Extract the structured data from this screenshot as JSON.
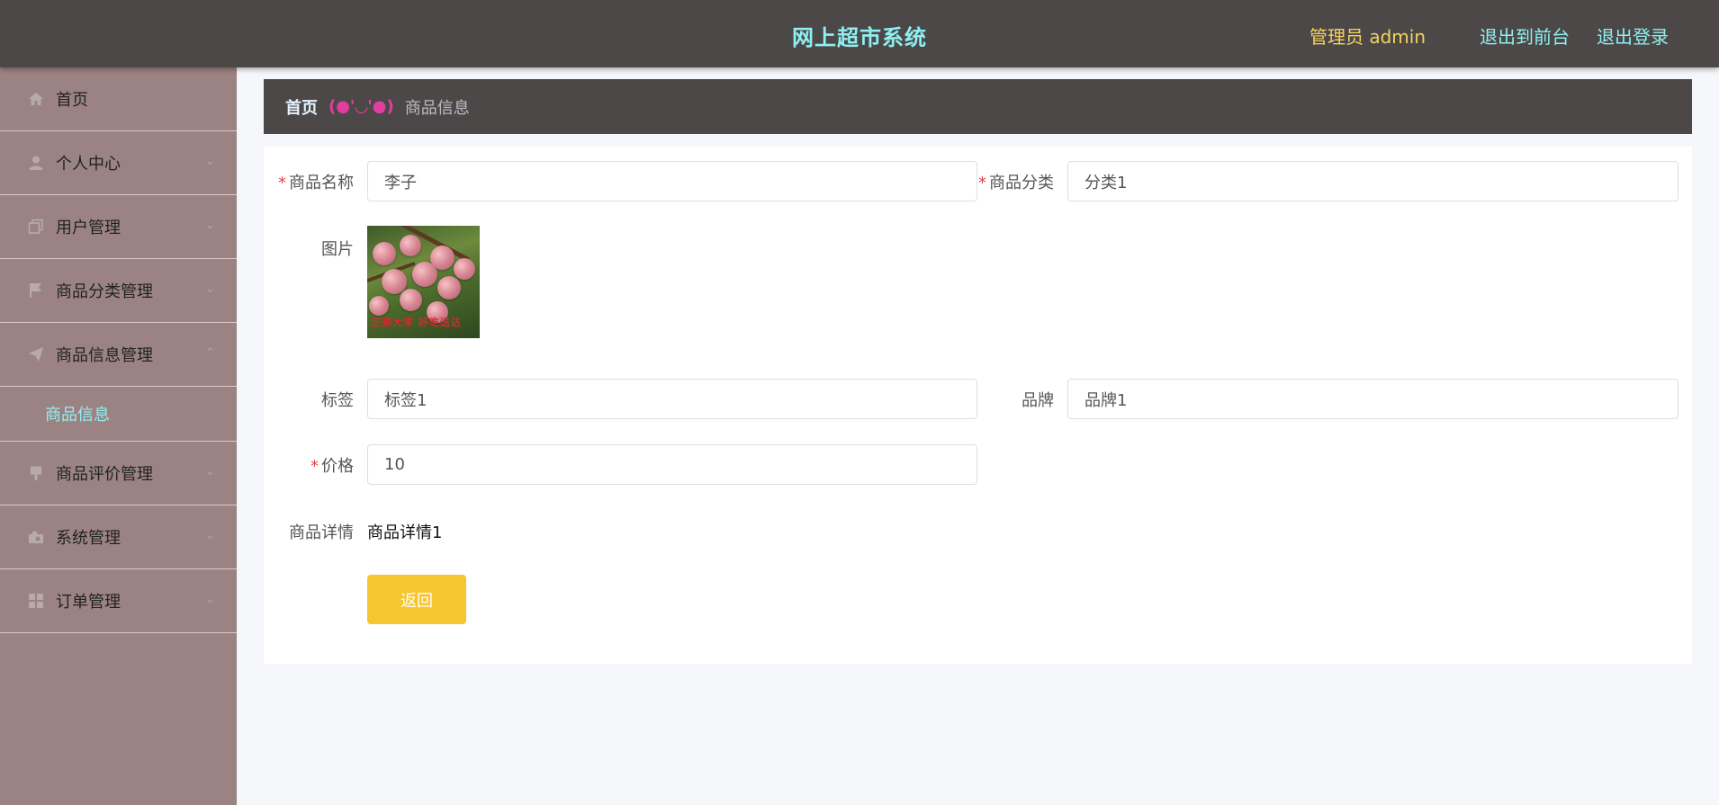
{
  "header": {
    "title": "网上超市系统",
    "admin": "管理员 admin",
    "to_front": "退出到前台",
    "logout": "退出登录"
  },
  "sidebar": {
    "items": [
      {
        "label": "首页",
        "icon": "home-icon"
      },
      {
        "label": "个人中心",
        "icon": "user-icon"
      },
      {
        "label": "用户管理",
        "icon": "copy-icon"
      },
      {
        "label": "商品分类管理",
        "icon": "flag-icon"
      },
      {
        "label": "商品信息管理",
        "icon": "send-icon",
        "expanded": true,
        "children": [
          "商品信息"
        ]
      },
      {
        "label": "商品评价管理",
        "icon": "pin-icon"
      },
      {
        "label": "系统管理",
        "icon": "camera-icon"
      },
      {
        "label": "订单管理",
        "icon": "grid-icon"
      }
    ]
  },
  "breadcrumb": {
    "home": "首页",
    "separator": "(●'◡'●)",
    "current": "商品信息"
  },
  "form": {
    "name_label": "商品名称",
    "name_value": "李子",
    "category_label": "商品分类",
    "category_value": "分类1",
    "image_label": "图片",
    "image_caption": "正宗大李 好吃送达",
    "tag_label": "标签",
    "tag_value": "标签1",
    "brand_label": "品牌",
    "brand_value": "品牌1",
    "price_label": "价格",
    "price_value": "10",
    "detail_label": "商品详情",
    "detail_value": "商品详情1",
    "back_button": "返回",
    "required_mark": "*"
  },
  "colors": {
    "header_bg": "#4d4848",
    "title": "#8ef0f2",
    "admin": "#f4d35e",
    "sidebar_bg": "#9b8383",
    "button": "#f6c630",
    "required": "#e0454b"
  }
}
